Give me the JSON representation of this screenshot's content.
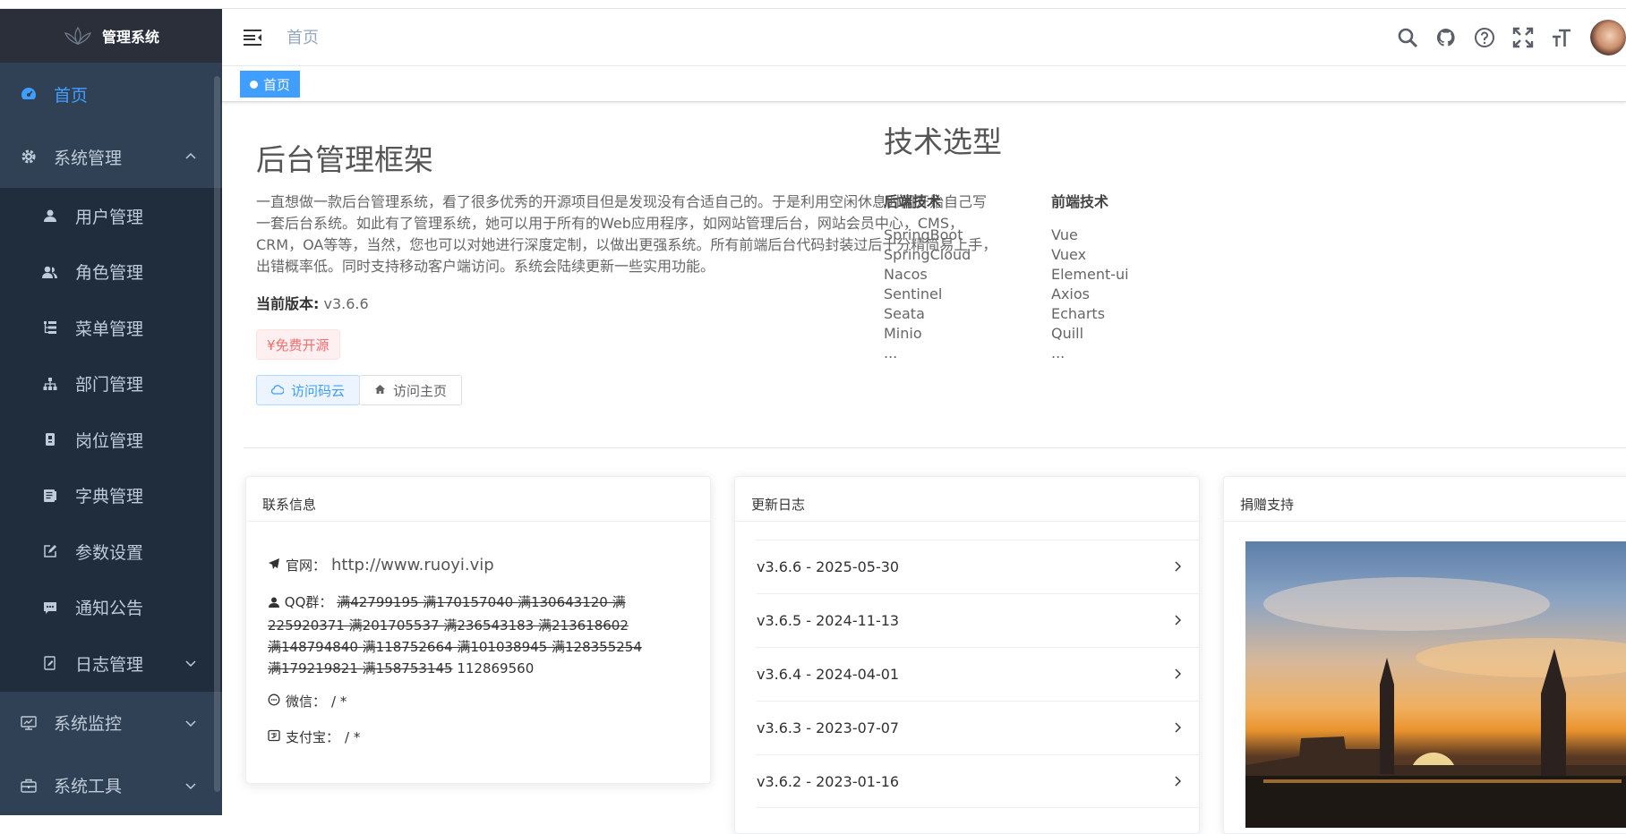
{
  "app": {
    "title": "管理系统"
  },
  "sidebar": {
    "items": [
      {
        "label": "首页",
        "icon": "dashboard-icon",
        "active": true
      },
      {
        "label": "系统管理",
        "icon": "gear-icon",
        "expanded": true,
        "children": [
          {
            "label": "用户管理",
            "icon": "user-icon"
          },
          {
            "label": "角色管理",
            "icon": "peoples-icon"
          },
          {
            "label": "菜单管理",
            "icon": "tree-table-icon"
          },
          {
            "label": "部门管理",
            "icon": "tree-icon"
          },
          {
            "label": "岗位管理",
            "icon": "post-icon"
          },
          {
            "label": "字典管理",
            "icon": "dict-icon"
          },
          {
            "label": "参数设置",
            "icon": "edit-icon"
          },
          {
            "label": "通知公告",
            "icon": "message-icon"
          },
          {
            "label": "日志管理",
            "icon": "log-icon"
          }
        ]
      },
      {
        "label": "系统监控",
        "icon": "monitor-icon"
      },
      {
        "label": "系统工具",
        "icon": "tool-icon"
      }
    ]
  },
  "navbar": {
    "breadcrumb": "首页"
  },
  "tags": [
    {
      "label": "首页",
      "active": true
    }
  ],
  "intro": {
    "title": "后台管理框架",
    "text": "一直想做一款后台管理系统，看了很多优秀的开源项目但是发现没有合适自己的。于是利用空闲休息时间开始自己写一套后台系统。如此有了管理系统，她可以用于所有的Web应用程序，如网站管理后台，网站会员中心，CMS，CRM，OA等等，当然，您也可以对她进行深度定制，以做出更强系统。所有前端后台代码封装过后十分精简易上手，出错概率低。同时支持移动客户端访问。系统会陆续更新一些实用功能。",
    "version_label": "当前版本:",
    "version": "v3.6.6",
    "free_tag": "¥免费开源",
    "btn_gitee": "访问码云",
    "btn_home": "访问主页"
  },
  "tech": {
    "title": "技术选型",
    "backend": {
      "title": "后端技术",
      "items": [
        "SpringBoot",
        "SpringCloud",
        "Nacos",
        "Sentinel",
        "Seata",
        "Minio",
        "..."
      ]
    },
    "frontend": {
      "title": "前端技术",
      "items": [
        "Vue",
        "Vuex",
        "Element-ui",
        "Axios",
        "Echarts",
        "Quill",
        "..."
      ]
    }
  },
  "contact": {
    "title": "联系信息",
    "site_label": "官网：",
    "site": "http://www.ruoyi.vip",
    "qq_label": "QQ群：",
    "qq_struck": "满42799195 满170157040 满130643120 满225920371 满201705537 满236543183 满213618602 满148794840 满118752664 满101038945 满128355254 满179219821 满158753145",
    "qq_active": "112869560",
    "wechat_label": "微信：",
    "wechat": "/ *",
    "alipay_label": "支付宝：",
    "alipay": "/ *"
  },
  "changelog": {
    "title": "更新日志",
    "items": [
      "v3.6.6 - 2025-05-30",
      "v3.6.5 - 2024-11-13",
      "v3.6.4 - 2024-04-01",
      "v3.6.3 - 2023-07-07",
      "v3.6.2 - 2023-01-16"
    ]
  },
  "donate": {
    "title": "捐赠支持"
  },
  "colors": {
    "sidebar": "#304156",
    "submenu": "#1f2d3d",
    "accent": "#409eff",
    "danger": "#f56c6c"
  }
}
